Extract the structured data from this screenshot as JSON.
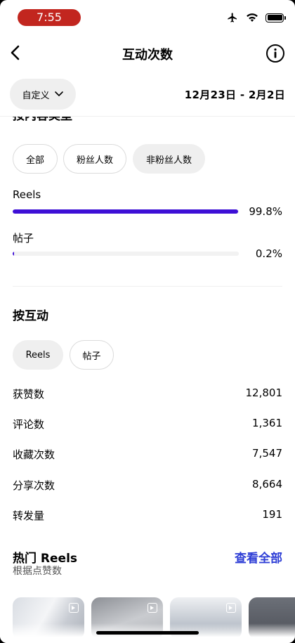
{
  "status_bar": {
    "time": "7:55"
  },
  "nav": {
    "title": "互动次数"
  },
  "filter": {
    "custom_label": "自定义",
    "date_range": "12月23日 - 2月2日"
  },
  "content_type": {
    "heading_cut": "按内容类型",
    "chips": [
      "全部",
      "粉丝人数",
      "非粉丝人数"
    ],
    "rows": [
      {
        "label": "Reels",
        "percent": 99.8,
        "percent_text": "99.8%"
      },
      {
        "label": "帖子",
        "percent": 0.2,
        "percent_text": "0.2%"
      }
    ]
  },
  "by_interaction": {
    "title": "按互动",
    "chips": [
      "Reels",
      "帖子"
    ],
    "metrics": [
      {
        "label": "获赞数",
        "value": "12,801"
      },
      {
        "label": "评论数",
        "value": "1,361"
      },
      {
        "label": "收藏次数",
        "value": "7,547"
      },
      {
        "label": "分享次数",
        "value": "8,664"
      },
      {
        "label": "转发量",
        "value": "191"
      }
    ]
  },
  "top_reels": {
    "title": "热门 Reels",
    "see_all": "查看全部",
    "subtitle": "根据点赞数"
  },
  "colors": {
    "accent_bar": "#3d0fd6",
    "link": "#2f3fd6",
    "time_pill": "#c2261f"
  }
}
